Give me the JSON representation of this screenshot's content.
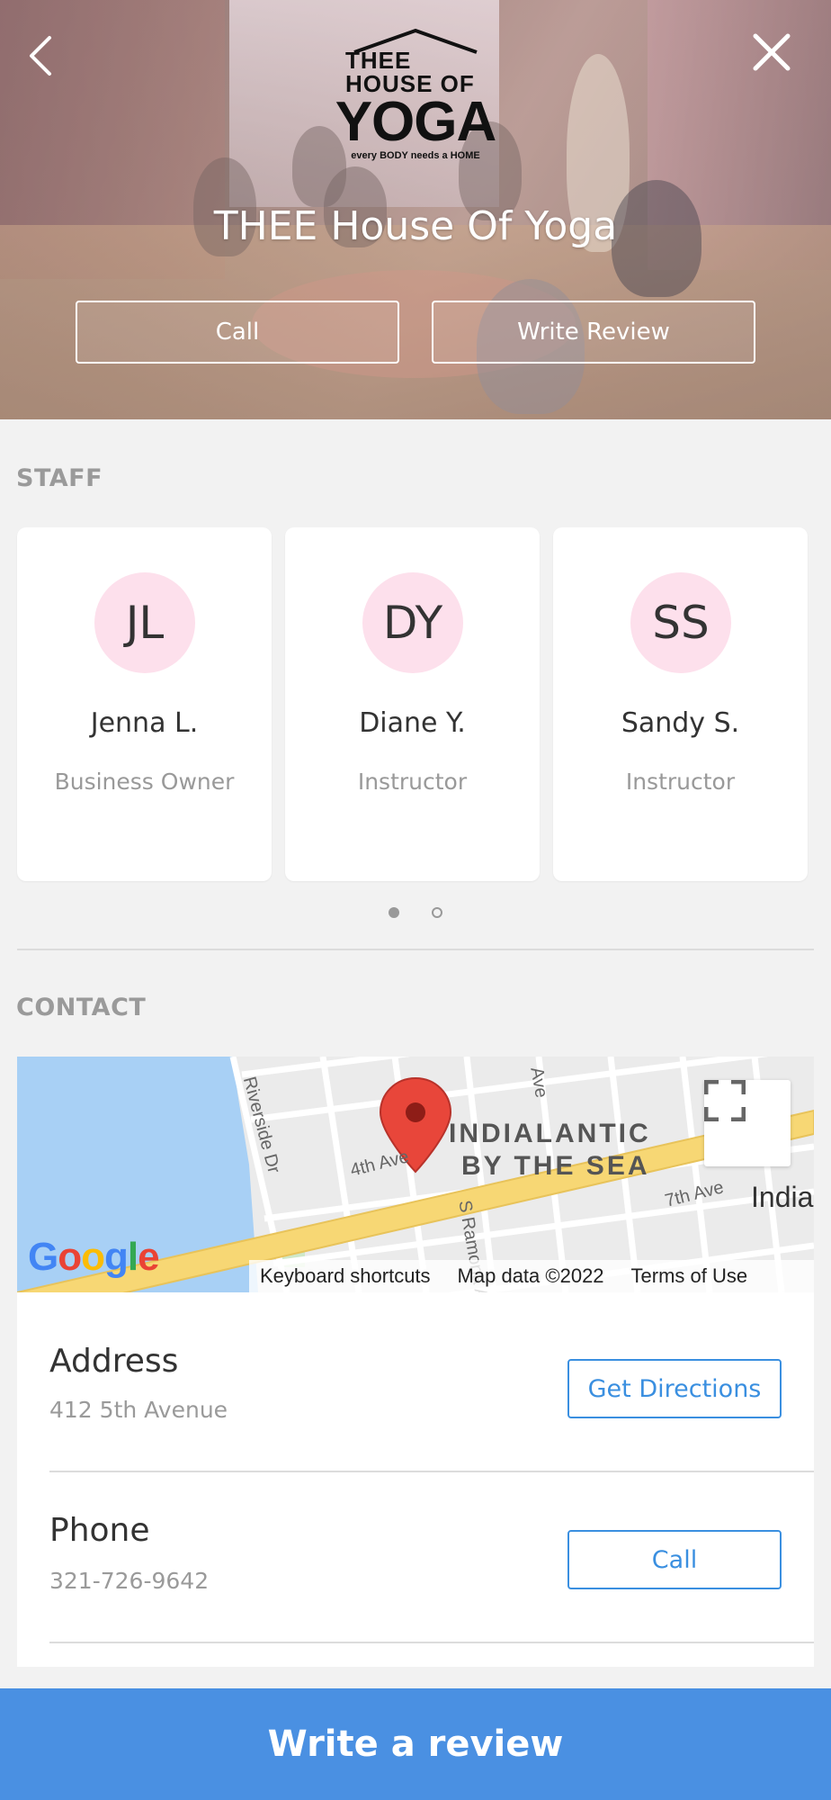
{
  "header": {
    "title": "THEE House Of Yoga",
    "logo": {
      "small_text": "THEE HOUSE OF",
      "big_text": "YOGA",
      "tagline": "every BODY needs a HOME"
    },
    "call_label": "Call",
    "write_review_label": "Write Review",
    "back_icon": "chevron-left-icon",
    "close_icon": "close-icon"
  },
  "staff": {
    "heading": "STAFF",
    "members": [
      {
        "initials": "JL",
        "name": "Jenna L.",
        "role": "Business Owner"
      },
      {
        "initials": "DY",
        "name": "Diane Y.",
        "role": "Instructor"
      },
      {
        "initials": "SS",
        "name": "Sandy S.",
        "role": "Instructor"
      }
    ],
    "pagination": {
      "current_page": 1,
      "total_pages": 2
    }
  },
  "contact": {
    "heading": "CONTACT",
    "map": {
      "area_label_line1": "INDIALANTIC",
      "area_label_line2": "BY THE SEA",
      "city_label": "India",
      "streets": [
        "Riverside Dr",
        "4th Ave",
        "7th Ave",
        "S Ramona Ave",
        "Ave"
      ],
      "google_logo": "Google",
      "keyboard_shortcuts": "Keyboard shortcuts",
      "map_data": "Map data ©2022",
      "terms": "Terms of Use",
      "fullscreen_icon": "fullscreen-icon",
      "marker_icon": "map-pin-icon"
    },
    "rows": [
      {
        "title": "Address",
        "value": "412 5th Avenue",
        "button": "Get Directions"
      },
      {
        "title": "Phone",
        "value": "321-726-9642",
        "button": "Call"
      }
    ]
  },
  "footer": {
    "cta_label": "Write a review"
  },
  "colors": {
    "accent": "#4a90e2",
    "button_outline": "#3a8fe0",
    "avatar_bg": "#fde0ec",
    "map_pin": "#e8463a",
    "water": "#a8d0f5",
    "highway": "#f7d774"
  }
}
